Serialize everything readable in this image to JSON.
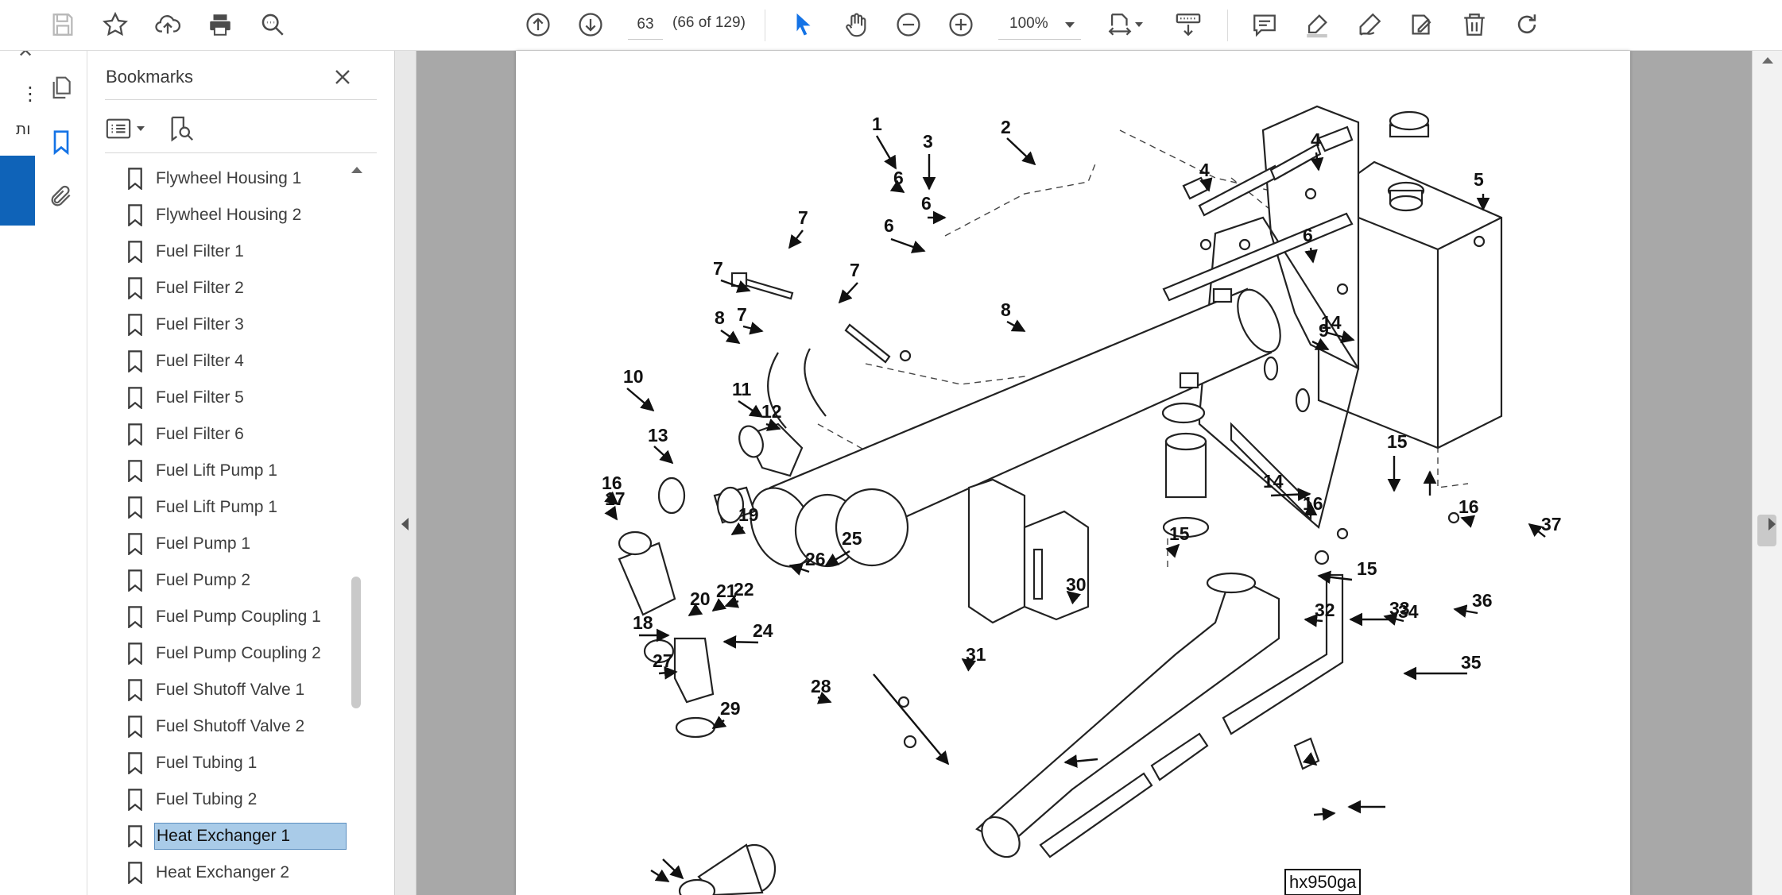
{
  "toolbar": {
    "page_number": "63",
    "page_count": "(66 of 129)",
    "zoom": "100%",
    "icons": [
      "save-icon",
      "bookmark-star-icon",
      "upload-cloud-icon",
      "print-icon",
      "zoom-search-icon",
      "previous-page-icon",
      "next-page-icon",
      "select-pointer-icon",
      "hand-icon",
      "zoom-out-icon",
      "zoom-in-icon",
      "fit-page-icon",
      "scroll-mode-icon",
      "comment-icon",
      "highlight-icon",
      "draw-icon",
      "fill-sign-icon",
      "delete-icon",
      "rotate-icon"
    ]
  },
  "outer": {
    "close_glyph": "✕",
    "menu_glyph": "⋮",
    "hebrew_fragment": "ות"
  },
  "panel": {
    "title": "Bookmarks",
    "bookmarks": [
      {
        "label": "Flywheel Housing 1"
      },
      {
        "label": "Flywheel Housing 2"
      },
      {
        "label": "Fuel Filter 1"
      },
      {
        "label": "Fuel Filter 2"
      },
      {
        "label": "Fuel Filter 3"
      },
      {
        "label": "Fuel Filter 4"
      },
      {
        "label": "Fuel Filter 5"
      },
      {
        "label": "Fuel Filter 6"
      },
      {
        "label": "Fuel Lift Pump 1"
      },
      {
        "label": "Fuel Lift Pump 1"
      },
      {
        "label": "Fuel Pump 1"
      },
      {
        "label": "Fuel Pump 2"
      },
      {
        "label": "Fuel Pump Coupling 1"
      },
      {
        "label": "Fuel Pump Coupling 2"
      },
      {
        "label": "Fuel Shutoff Valve 1"
      },
      {
        "label": "Fuel Shutoff Valve 2"
      },
      {
        "label": "Fuel Tubing 1"
      },
      {
        "label": "Fuel Tubing 2"
      },
      {
        "label": "Heat Exchanger 1",
        "selected": true
      },
      {
        "label": "Heat Exchanger 2"
      }
    ]
  },
  "diagram": {
    "figure_id": "hx950ga",
    "callouts": [
      "1",
      "2",
      "3",
      "4",
      "4",
      "5",
      "6",
      "6",
      "6",
      "6",
      "7",
      "7",
      "7",
      "7",
      "8",
      "8",
      "9",
      "10",
      "11",
      "12",
      "13",
      "14",
      "14",
      "15",
      "15",
      "15",
      "16",
      "16",
      "16",
      "17",
      "18",
      "19",
      "20",
      "21",
      "22",
      "24",
      "25",
      "26",
      "27",
      "28",
      "29",
      "30",
      "31",
      "32",
      "33",
      "34",
      "35",
      "36",
      "37"
    ]
  },
  "colors": {
    "accent": "#1473e6",
    "selection": "#a9cbe8",
    "doc_background": "#a8a8a8"
  }
}
